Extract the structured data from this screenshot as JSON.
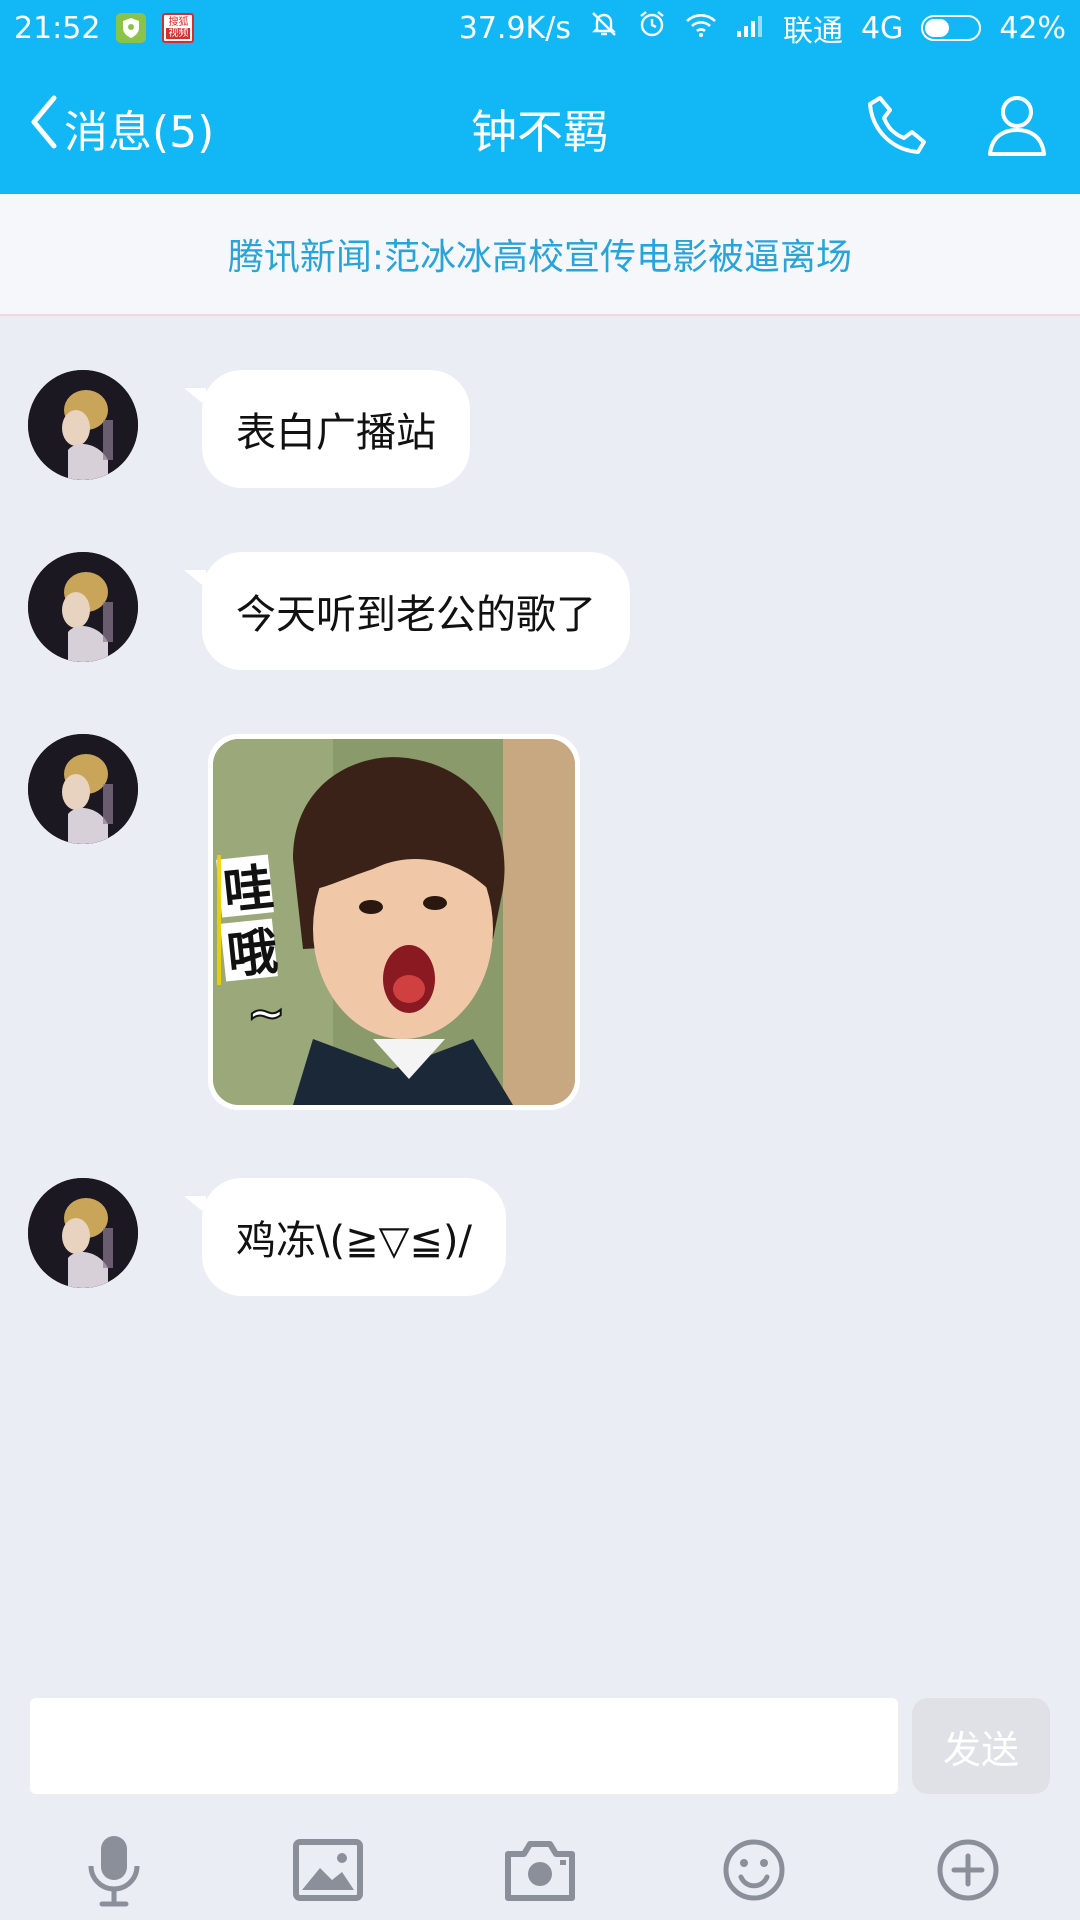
{
  "status": {
    "time": "21:52",
    "badge_text_top": "搜狐",
    "badge_text_bottom": "视频",
    "speed": "37.9K/s",
    "carrier": "联通",
    "network": "4G",
    "battery": "42%",
    "battery_level": 0.42
  },
  "header": {
    "back_label": "消息(5)",
    "title": "钟不羁"
  },
  "news": {
    "text": "腾讯新闻:范冰冰高校宣传电影被逼离场"
  },
  "messages": [
    {
      "type": "text",
      "text": "表白广播站"
    },
    {
      "type": "text",
      "text": "今天听到老公的歌了"
    },
    {
      "type": "sticker",
      "caption": "哇哦~"
    },
    {
      "type": "text",
      "text": "鸡冻\\(≧▽≦)/"
    }
  ],
  "composer": {
    "input_value": "",
    "send_label": "发送"
  },
  "toolbar": {
    "icons": [
      "microphone-icon",
      "image-icon",
      "camera-icon",
      "emoji-icon",
      "plus-icon"
    ]
  },
  "colors": {
    "primary": "#12b7f5",
    "background": "#ebedf5",
    "news_text": "#2aa3d6"
  }
}
